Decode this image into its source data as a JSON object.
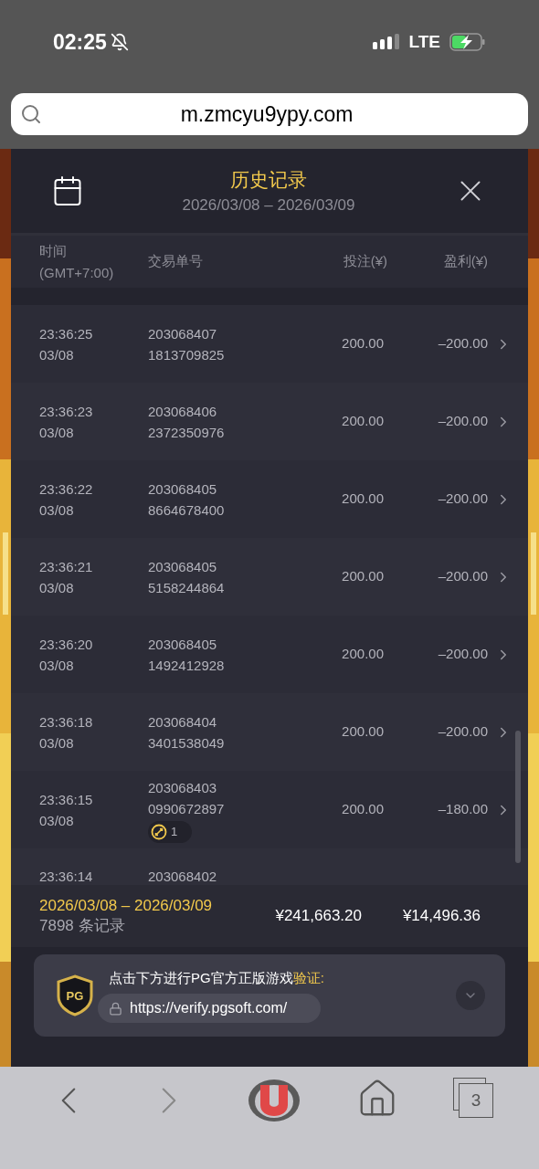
{
  "status_bar": {
    "time": "02:25",
    "network": "LTE"
  },
  "address_bar": {
    "url": "m.zmcyu9ypy.com"
  },
  "header": {
    "title": "历史记录",
    "date_range": "2026/03/08 – 2026/03/09"
  },
  "table": {
    "columns": [
      {
        "label": "时间",
        "sub": "(GMT+7:00)"
      },
      {
        "label": "交易单号"
      },
      {
        "label": "投注(¥)"
      },
      {
        "label": "盈利(¥)"
      }
    ],
    "rows": [
      {
        "time": "23:36:25",
        "date": "03/08",
        "order": [
          "203068407",
          "1813709825"
        ],
        "bet": "200.00",
        "profit": "–200.00"
      },
      {
        "time": "23:36:23",
        "date": "03/08",
        "order": [
          "203068406",
          "2372350976"
        ],
        "bet": "200.00",
        "profit": "–200.00"
      },
      {
        "time": "23:36:22",
        "date": "03/08",
        "order": [
          "203068405",
          "8664678400"
        ],
        "bet": "200.00",
        "profit": "–200.00"
      },
      {
        "time": "23:36:21",
        "date": "03/08",
        "order": [
          "203068405",
          "5158244864"
        ],
        "bet": "200.00",
        "profit": "–200.00"
      },
      {
        "time": "23:36:20",
        "date": "03/08",
        "order": [
          "203068405",
          "1492412928"
        ],
        "bet": "200.00",
        "profit": "–200.00"
      },
      {
        "time": "23:36:18",
        "date": "03/08",
        "order": [
          "203068404",
          "3401538049"
        ],
        "bet": "200.00",
        "profit": "–200.00"
      },
      {
        "time": "23:36:15",
        "date": "03/08",
        "order": [
          "203068403",
          "0990672897"
        ],
        "bet": "200.00",
        "profit": "–180.00",
        "badge": "1"
      },
      {
        "time": "23:36:14",
        "order": [
          "203068402"
        ]
      }
    ]
  },
  "summary": {
    "date_range": "2026/03/08 – 2026/03/09",
    "count": "7898 条记录",
    "total_bet": "¥241,663.20",
    "total_profit": "¥14,496.36"
  },
  "verify": {
    "text": "点击下方进行PG官方正版游戏",
    "link_word": "验证",
    "colon": ":",
    "logo": "PG",
    "url": "https://verify.pgsoft.com/"
  },
  "toolbar": {
    "back_enabled": true,
    "forward_enabled": false,
    "tabs_count": "3"
  }
}
